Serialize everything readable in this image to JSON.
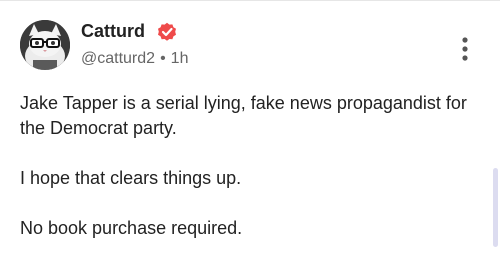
{
  "author": {
    "display_name": "Catturd",
    "handle": "@catturd2",
    "separator": "•",
    "time_ago": "1h",
    "verified": true
  },
  "post": {
    "paragraphs": [
      "Jake Tapper is a serial lying, fake news propagandist for the Democrat party.",
      "I hope that clears things up.",
      "No book purchase required."
    ]
  },
  "icons": {
    "verified": "verified-badge-icon",
    "more": "more-vertical-icon",
    "avatar": "cat-with-glasses-avatar"
  },
  "colors": {
    "verified_badge": "#ef4a4a",
    "name_text": "#222222",
    "meta_text": "#666666",
    "scrollbar_thumb": "#dcdcf0"
  }
}
